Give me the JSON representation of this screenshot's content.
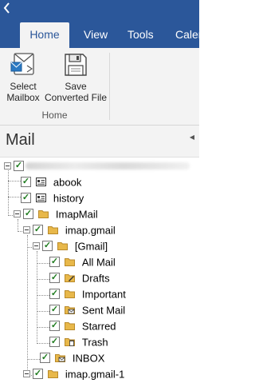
{
  "ribbon": {
    "tabs": [
      {
        "label": "Home",
        "active": true
      },
      {
        "label": "View",
        "active": false
      },
      {
        "label": "Tools",
        "active": false
      },
      {
        "label": "Calen",
        "active": false
      }
    ],
    "buttons": [
      {
        "line1": "Select",
        "line2": "Mailbox",
        "icon": "mailbox-envelope-icon"
      },
      {
        "line1": "Save",
        "line2": "Converted File",
        "icon": "floppy-disk-icon"
      }
    ],
    "group_label": "Home"
  },
  "pane": {
    "title": "Mail"
  },
  "tree": {
    "nodes": [
      {
        "label": "abook",
        "icon": "contacts-card-icon"
      },
      {
        "label": "history",
        "icon": "contacts-card-icon"
      },
      {
        "label": "ImapMail",
        "icon": "folder-icon"
      },
      {
        "label": "imap.gmail",
        "icon": "folder-icon"
      },
      {
        "label": "[Gmail]",
        "icon": "folder-icon"
      },
      {
        "label": "All Mail",
        "icon": "folder-icon"
      },
      {
        "label": "Drafts",
        "icon": "drafts-folder-icon"
      },
      {
        "label": "Important",
        "icon": "folder-icon"
      },
      {
        "label": "Sent Mail",
        "icon": "sent-folder-icon"
      },
      {
        "label": "Starred",
        "icon": "folder-icon"
      },
      {
        "label": "Trash",
        "icon": "trash-folder-icon"
      },
      {
        "label": "INBOX",
        "icon": "inbox-folder-icon"
      },
      {
        "label": "imap.gmail-1",
        "icon": "folder-icon"
      }
    ]
  },
  "colors": {
    "ribbon_blue": "#2b579a",
    "folder_yellow": "#e8b84a",
    "check_green": "#1e7b1e"
  }
}
